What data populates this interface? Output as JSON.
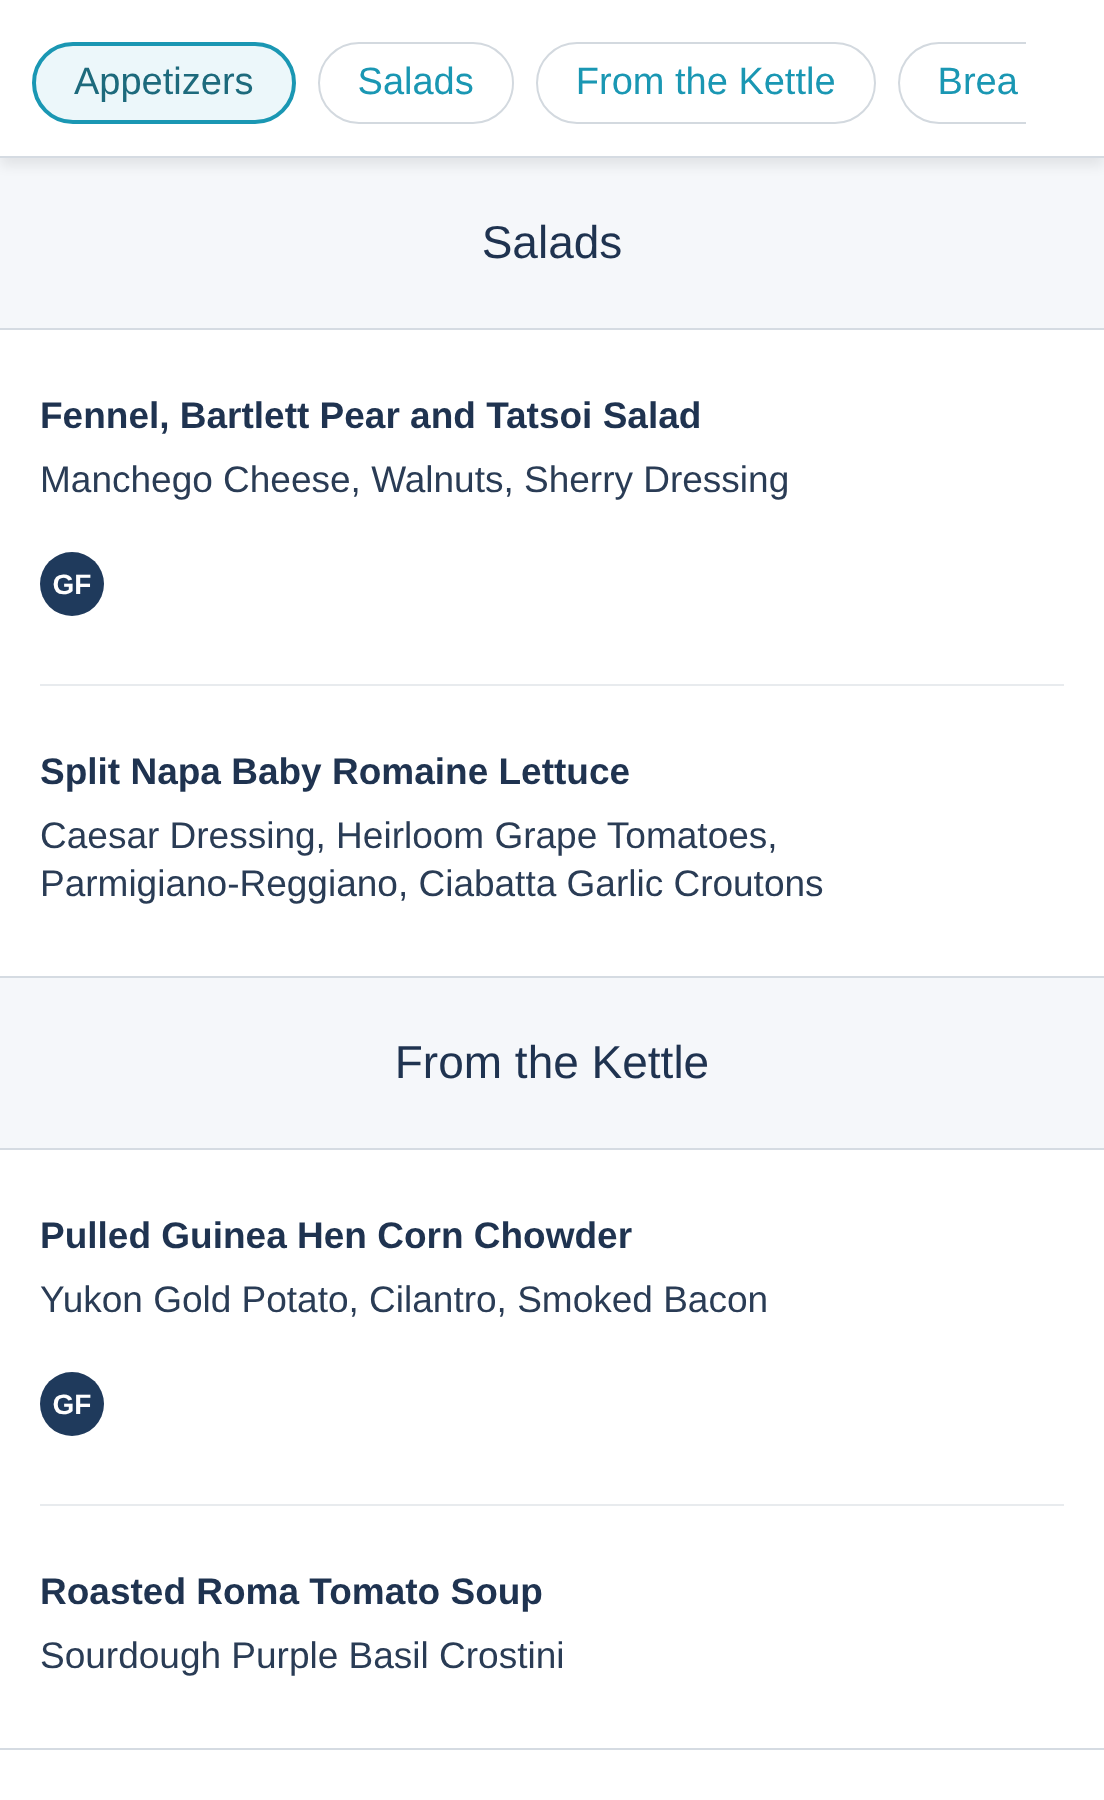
{
  "tabs": [
    {
      "label": "Appetizers",
      "selected": true
    },
    {
      "label": "Salads",
      "selected": false
    },
    {
      "label": "From the Kettle",
      "selected": false
    },
    {
      "label": "Brea",
      "selected": false
    }
  ],
  "sections": [
    {
      "title": "Salads",
      "items": [
        {
          "name": "Fennel, Bartlett Pear and Tatsoi Salad",
          "description": "Manchego Cheese, Walnuts, Sherry Dressing",
          "badges": [
            "GF"
          ]
        },
        {
          "name": "Split Napa Baby Romaine Lettuce",
          "description": "Caesar Dressing, Heirloom Grape Tomatoes, Parmigiano-Reggiano, Ciabatta Garlic Croutons"
        }
      ]
    },
    {
      "title": "From the Kettle",
      "items": [
        {
          "name": "Pulled Guinea Hen Corn Chowder",
          "description": "Yukon Gold Potato, Cilantro, Smoked Bacon",
          "badges": [
            "GF"
          ]
        },
        {
          "name": "Roasted Roma Tomato Soup",
          "description": "Sourdough Purple Basil Crostini"
        }
      ]
    }
  ]
}
